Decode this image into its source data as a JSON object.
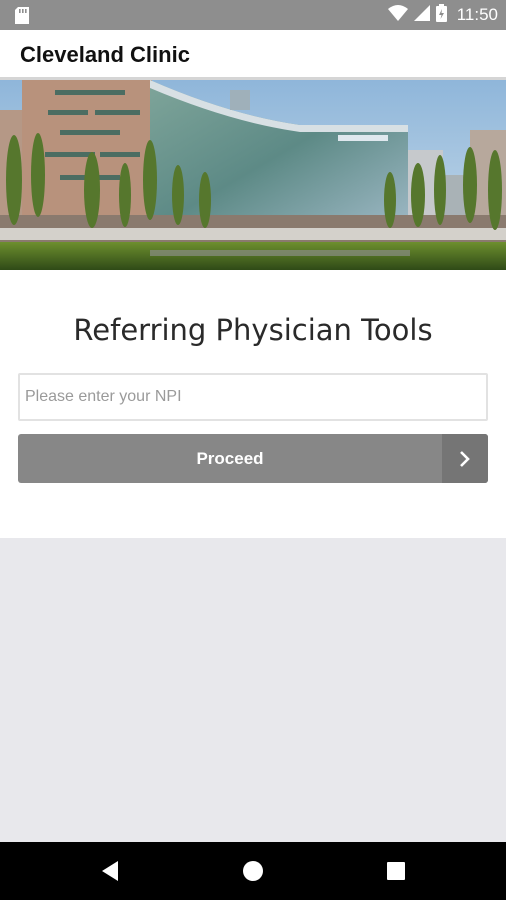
{
  "status_bar": {
    "time": "11:50",
    "icons": [
      "sd-card-icon",
      "wifi-icon",
      "signal-icon",
      "battery-icon"
    ]
  },
  "app_bar": {
    "title": "Cleveland Clinic"
  },
  "hero": {
    "image": "hospital-building-photo"
  },
  "main": {
    "heading": "Referring Physician Tools",
    "npi_input": {
      "value": "",
      "placeholder": "Please enter your NPI"
    },
    "proceed_button": {
      "label": "Proceed",
      "icon": "chevron-right-icon"
    }
  },
  "nav_bar": {
    "buttons": [
      "back-icon",
      "home-icon",
      "recents-icon"
    ]
  },
  "colors": {
    "status_bar": "#8e8e8e",
    "button": "#878787",
    "button_chevron_area": "#757575",
    "background": "#e8e8ec"
  }
}
